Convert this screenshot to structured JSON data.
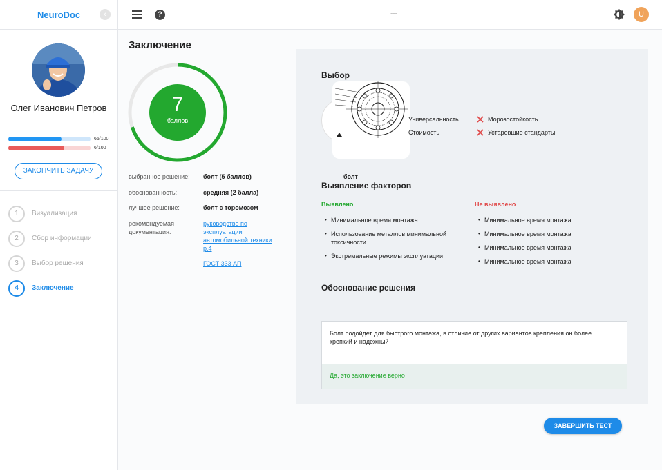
{
  "app": {
    "logo": "NeuroDoc",
    "header_title": "---",
    "user_initial": "U"
  },
  "sidebar": {
    "user_name": "Олег Иванович Петров",
    "progress": [
      {
        "label": "65/100",
        "value": 0.65,
        "color": "#2196f3",
        "track": "#cfe6fb"
      },
      {
        "label": "6/100",
        "value": 0.68,
        "color": "#e85a5a",
        "track": "#f9d5d5"
      }
    ],
    "finish_task_label": "ЗАКОНЧИТЬ ЗАДАЧУ",
    "steps": [
      {
        "num": "1",
        "label": "Визуализация"
      },
      {
        "num": "2",
        "label": "Сбор информации"
      },
      {
        "num": "3",
        "label": "Выбор решения"
      },
      {
        "num": "4",
        "label": "Заключение"
      }
    ]
  },
  "conclusion": {
    "title": "Заключение",
    "score": "7",
    "score_unit": "баллов",
    "score_fraction": 0.7,
    "rows": [
      {
        "key": "выбранное решение:",
        "value": "болт (5 баллов)"
      },
      {
        "key": "обоснованность:",
        "value": "средняя (2 балла)"
      },
      {
        "key": "лучшее решение:",
        "value": "болт с торомозом"
      },
      {
        "key": "рекомендуемая документация:"
      }
    ],
    "docs": [
      "руководство по эксплуатации автомобильной техники р.4",
      "ГОСТ 333 АП"
    ]
  },
  "panel": {
    "choice_title": "Выбор",
    "solution_label": "болт",
    "criteria_positive": [
      "Универсальность",
      "Стоимость"
    ],
    "criteria_negative": [
      "Морозостойкость",
      "Устаревшие стандарты"
    ],
    "factors_title": "Выявление факторов",
    "found_label": "Выявлено",
    "not_found_label": "Не выявлено",
    "found": [
      "Минимальное время монтажа",
      "Использование металлов минимальной токсичности",
      "Экстремальные режимы эксплуатации"
    ],
    "not_found": [
      "Минимальное время монтажа",
      "Минимальное время монтажа",
      "Минимальное время монтажа",
      "Минимальное время монтажа"
    ],
    "justification_title": "Обоснование решения",
    "justification_text": "Болт подойдет для быстрого монтажа, в отличие от других вариантов крепления он более крепкий и надежный",
    "verdict": "Да, это заключение верно"
  },
  "finish_test_label": "ЗАВЕРШИТЬ ТЕСТ",
  "colors": {
    "accent": "#1e8be8",
    "success": "#23a82f",
    "danger": "#e04848"
  }
}
